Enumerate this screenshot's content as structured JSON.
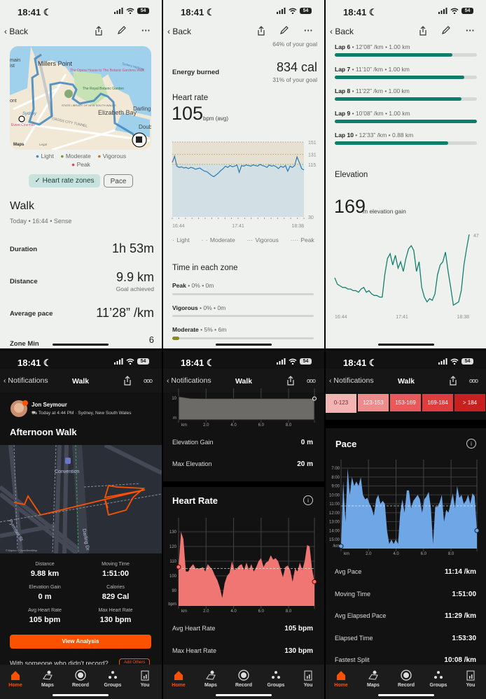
{
  "status_bar": {
    "time": "18:41",
    "battery": "54"
  },
  "colors": {
    "fit_teal": "#0e7d6b",
    "fit_hr_line": "#2b7bab",
    "strava_orange": "#fc5200",
    "strava_hr_fill": "#ef7673",
    "strava_pace_fill": "#6fa6e6"
  },
  "fit_nav": {
    "back": "Back",
    "icons": [
      "share-icon",
      "pencil-icon",
      "more-icon"
    ]
  },
  "fit_summary": {
    "map_labels": {
      "millers_point": "Millers Point",
      "opera_walk": "The Opera House to The Botanic Gardens Walk",
      "botanic": "The Royal Botanic Garden",
      "library": "STATE LIBRARY OF NEW SOUTH WALES",
      "elizabeth_bay": "Elizabeth Bay",
      "darling_point": "Darling Point",
      "tunnel": "CROSS CITY TUNNEL",
      "cinemas": "Event Cinemas",
      "harbour": "Sydney Harbour",
      "sydney": "Sydney",
      "maps": "Maps",
      "legal": "Legal",
      "doub": "Doub",
      "main": "main",
      "st": "ist",
      "ont": "ont"
    },
    "legend": [
      {
        "label": "Light",
        "color": "#3a8ab8"
      },
      {
        "label": "Moderate",
        "color": "#8a8a30"
      },
      {
        "label": "Vigorous",
        "color": "#b8773a"
      },
      {
        "label": "Peak",
        "color": "#d44a5c"
      }
    ],
    "chips": {
      "hr_zones": "Heart rate zones",
      "pace": "Pace",
      "check": "✓"
    },
    "title": "Walk",
    "subtitle": "Today • 16:44 • Sense",
    "stats": [
      {
        "label": "Duration",
        "value": "1h 53m"
      },
      {
        "label": "Distance",
        "value": "9.9 km",
        "note": "Goal achieved"
      },
      {
        "label": "Average pace",
        "value": "11’28” /km"
      },
      {
        "label": "Zone Min",
        "value": "6"
      }
    ]
  },
  "fit_heart": {
    "steps_goal_note": "64% of your goal",
    "energy_label": "Energy burned",
    "energy_value": "834 cal",
    "energy_note": "31% of your goal",
    "hr_title": "Heart rate",
    "hr_avg": "105",
    "hr_unit": "bpm (avg)",
    "legend": [
      "Light",
      "Moderate",
      "Vigorous",
      "Peak"
    ],
    "zone_title": "Time in each zone",
    "zones": [
      {
        "name": "Peak",
        "detail": " • 0% • 0m",
        "fraction": 0
      },
      {
        "name": "Vigorous",
        "detail": " • 0% • 0m",
        "fraction": 0
      },
      {
        "name": "Moderate",
        "detail": " • 5% • 6m",
        "fraction": 0.05
      }
    ]
  },
  "fit_laps": {
    "laps": [
      {
        "name": "Lap 6",
        "detail": " • 12’08” /km • 1.00 km",
        "fraction": 0.83
      },
      {
        "name": "Lap 7",
        "detail": " • 11’10” /km • 1.00 km",
        "fraction": 0.91
      },
      {
        "name": "Lap 8",
        "detail": " • 11’22” /km • 1.00 km",
        "fraction": 0.89
      },
      {
        "name": "Lap 9",
        "detail": " • 10’08” /km • 1.00 km",
        "fraction": 1.0
      },
      {
        "name": "Lap 10",
        "detail": " • 12’33” /km • 0.88 km",
        "fraction": 0.8
      }
    ],
    "elev_title": "Elevation",
    "elev_gain": "169",
    "elev_unit": "m elevation gain"
  },
  "strava_nav": {
    "back": "Notifications",
    "title": "Walk"
  },
  "strava_overview": {
    "athlete": "Jon Seymour",
    "meta": "Today at 4:44 PM · Sydney, New South Wales",
    "activity_title": "Afternoon Walk",
    "map_labels": {
      "convention": "Convention",
      "pyrmont": "Pyrmont St",
      "darling": "Darling Dr",
      "credit": "© Mapbox © OpenStreetMap"
    },
    "stats": [
      {
        "label": "Distance",
        "value": "9.88 km"
      },
      {
        "label": "Moving Time",
        "value": "1:51:00"
      },
      {
        "label": "Elevation Gain",
        "value": "0 m"
      },
      {
        "label": "Calories",
        "value": "829 Cal"
      },
      {
        "label": "Avg Heart Rate",
        "value": "105 bpm"
      },
      {
        "label": "Max Heart Rate",
        "value": "130 bpm"
      }
    ],
    "view_analysis": "View Analysis",
    "prompt": "With someone who didn't record?",
    "add_others": "Add Others"
  },
  "strava_hr": {
    "elev_rows": [
      {
        "label": "Elevation Gain",
        "value": "0 m"
      },
      {
        "label": "Max Elevation",
        "value": "20 m"
      }
    ],
    "title": "Heart Rate",
    "rows": [
      {
        "label": "Avg Heart Rate",
        "value": "105 bpm"
      },
      {
        "label": "Max Heart Rate",
        "value": "130 bpm"
      }
    ]
  },
  "strava_pace": {
    "zones": [
      {
        "label": "0-123",
        "color": "#f3b4b4",
        "selected": true
      },
      {
        "label": "123-153",
        "color": "#ee8b8b"
      },
      {
        "label": "153-169",
        "color": "#e85a5a"
      },
      {
        "label": "169-184",
        "color": "#e03c3c"
      },
      {
        "label": "> 184",
        "color": "#c81f1f"
      }
    ],
    "title": "Pace",
    "rows": [
      {
        "label": "Avg Pace",
        "value": "11:14 /km"
      },
      {
        "label": "Moving Time",
        "value": "1:51:00"
      },
      {
        "label": "Avg Elapsed Pace",
        "value": "11:29 /km"
      },
      {
        "label": "Elapsed Time",
        "value": "1:53:30"
      },
      {
        "label": "Fastest Split",
        "value": "10:08 /km"
      }
    ]
  },
  "tabs": [
    "Home",
    "Maps",
    "Record",
    "Groups",
    "You"
  ],
  "chart_data": [
    {
      "id": "fit_hr",
      "type": "line",
      "x_range": [
        "16:44",
        "18:38"
      ],
      "x_ticks": [
        "16:44",
        "17:41",
        "18:38"
      ],
      "y_ticks": [
        "151",
        "131",
        "115",
        "30"
      ],
      "ylim": [
        30,
        151
      ],
      "zone_lines": [
        {
          "value": 151,
          "color": "#d98a7a"
        },
        {
          "value": 131,
          "color": "#c8a060"
        },
        {
          "value": 115,
          "color": "#a8a34a"
        }
      ],
      "values": [
        118,
        128,
        112,
        110,
        111,
        109,
        110,
        108,
        110,
        109,
        107,
        108,
        109,
        106,
        104,
        103,
        100,
        97,
        95,
        98,
        101,
        105,
        108,
        112,
        110,
        113,
        111,
        112,
        114,
        102,
        113,
        112,
        114,
        113,
        112,
        114,
        113,
        112,
        115,
        113,
        112,
        110,
        114,
        112,
        113,
        111,
        108,
        112,
        110,
        113,
        104,
        112,
        110,
        113,
        127,
        118,
        108,
        106
      ]
    },
    {
      "id": "fit_elev",
      "type": "line",
      "x_range": [
        "16:44",
        "18:38"
      ],
      "x_ticks": [
        "16:44",
        "17:41",
        "18:38"
      ],
      "y_ticks": [
        "47"
      ],
      "ylim": [
        0,
        47
      ],
      "values": [
        20,
        16,
        15,
        14,
        14,
        13,
        13,
        12,
        12,
        11,
        13,
        14,
        11,
        12,
        10,
        9,
        9,
        8,
        8,
        22,
        32,
        35,
        28,
        34,
        26,
        30,
        24,
        32,
        38,
        40,
        37,
        24,
        30,
        14,
        8,
        5,
        7,
        6,
        10,
        22,
        28,
        30,
        36,
        24,
        14,
        3,
        4,
        5,
        12,
        28,
        38,
        47
      ]
    },
    {
      "id": "strava_elev",
      "type": "area",
      "xlabel": "km",
      "x_ticks": [
        "2.0",
        "4.0",
        "6.0",
        "8.0"
      ],
      "y_ticks": [
        "10",
        "m"
      ],
      "xlim": [
        0,
        9.88
      ],
      "ylim": [
        0,
        10
      ],
      "values": [
        10.4,
        9.6,
        9.5,
        9.5,
        9.5,
        9.5,
        9.5,
        9.5,
        9.5,
        9.5,
        9.5,
        9.5,
        9.5
      ]
    },
    {
      "id": "strava_hr",
      "type": "area",
      "xlabel": "km",
      "ylabel": "bpm",
      "x_ticks": [
        "2.0",
        "4.0",
        "6.0",
        "8.0"
      ],
      "y_ticks": [
        "130",
        "120",
        "110",
        "100",
        "90"
      ],
      "xlim": [
        0,
        9.88
      ],
      "avg": 105,
      "values": [
        106,
        130,
        125,
        103,
        103,
        106,
        108,
        105,
        105,
        105,
        106,
        103,
        108,
        106,
        104,
        100,
        97,
        92,
        85,
        95,
        100,
        102,
        110,
        104,
        105,
        107,
        108,
        104,
        109,
        104,
        108,
        103,
        106,
        110,
        112,
        106,
        109,
        110,
        114,
        111,
        112,
        110,
        105,
        99,
        106,
        107,
        104,
        96,
        105,
        103,
        109,
        104,
        110,
        121,
        120,
        105,
        96
      ]
    },
    {
      "id": "strava_pace",
      "type": "area",
      "xlabel": "km",
      "ylabel": "/km",
      "x_ticks": [
        "2.0",
        "4.0",
        "6.0",
        "8.0"
      ],
      "y_ticks": [
        "7:00",
        "8:00",
        "9:00",
        "10:00",
        "11:00",
        "12:00",
        "13:00",
        "14:00",
        "15:00"
      ],
      "xlim": [
        0,
        9.88
      ],
      "avg": "11:14",
      "values": [
        "15:45",
        "8:30",
        "13:00",
        "7:00",
        "10:00",
        "8:00",
        "9:00",
        "8:30",
        "9:00",
        "8:00",
        "10:00",
        "10:30",
        "10:20",
        "11:00",
        "11:30",
        "12:20",
        "10:30",
        "10:00",
        "11:00",
        "10:40",
        "11:00",
        "14:00",
        "15:30",
        "15:00",
        "15:30",
        "15:00",
        "15:30",
        "12:00",
        "10:30",
        "12:00",
        "9:30",
        "9:30",
        "11:30",
        "10:40",
        "10:20",
        "10:00",
        "10:30",
        "12:00",
        "10:30",
        "10:10",
        "9:40",
        "11:30",
        "15:30",
        "11:20",
        "11:20",
        "10:50",
        "10:00",
        "13:00",
        "11:40",
        "12:00",
        "11:00",
        "9:50",
        "11:30",
        "9:00",
        "10:20",
        "10:00",
        "11:00",
        "10:40",
        "10:00",
        "11:00",
        "9:50",
        "10:10",
        "14:00"
      ]
    }
  ]
}
